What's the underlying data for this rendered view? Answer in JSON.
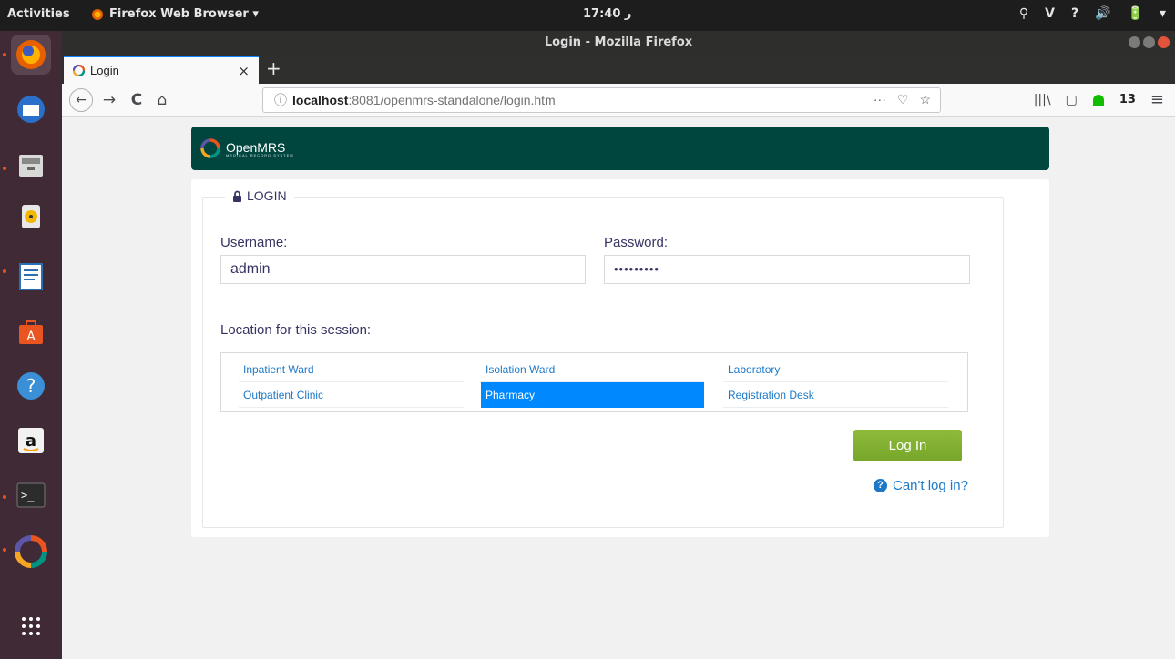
{
  "system": {
    "activities": "Activities",
    "app_menu": "Firefox Web Browser ▾",
    "clock": "17:40 ر",
    "tray": [
      "⚲",
      "V",
      "?",
      "🔊",
      "🔋",
      "▾"
    ]
  },
  "window": {
    "title": "Login - Mozilla Firefox"
  },
  "tab": {
    "title": "Login",
    "close": "×",
    "new_tab": "+"
  },
  "toolbar": {
    "back": "←",
    "forward": "→",
    "reload": "C",
    "home": "⌂",
    "url_host": "localhost",
    "url_rest": ":8081/openmrs-standalone/login.htm",
    "url_info_icon": "ⓘ",
    "page_actions": "···",
    "pocket": "♡",
    "bookmark_star": "☆",
    "library": "|||\\",
    "sidebar": "▢",
    "container_count": "13",
    "menu": "≡"
  },
  "dock": {
    "items": [
      "firefox",
      "thunderbird",
      "files",
      "rhythmbox",
      "libreoffice-writer",
      "software-center",
      "help",
      "amazon",
      "terminal",
      "openmrs"
    ],
    "apps_grid": "⋮⋮"
  },
  "header": {
    "brand": "OpenMRS",
    "tagline": "MEDICAL RECORD SYSTEM"
  },
  "login": {
    "legend": "LOGIN",
    "username_label": "Username:",
    "username_value": "admin",
    "password_label": "Password:",
    "password_value": "•••••••••",
    "location_label": "Location for this session:",
    "locations": [
      {
        "name": "Inpatient Ward",
        "selected": false
      },
      {
        "name": "Isolation Ward",
        "selected": false
      },
      {
        "name": "Laboratory",
        "selected": false
      },
      {
        "name": "Outpatient Clinic",
        "selected": false
      },
      {
        "name": "Pharmacy",
        "selected": true
      },
      {
        "name": "Registration Desk",
        "selected": false
      }
    ],
    "login_button": "Log In",
    "cant_login": "Can't log in?"
  },
  "colors": {
    "header_bg": "#00463f",
    "accent_blue": "#0088ff",
    "button_green": "#7eab2f",
    "dock_bg": "#3f2a35"
  }
}
